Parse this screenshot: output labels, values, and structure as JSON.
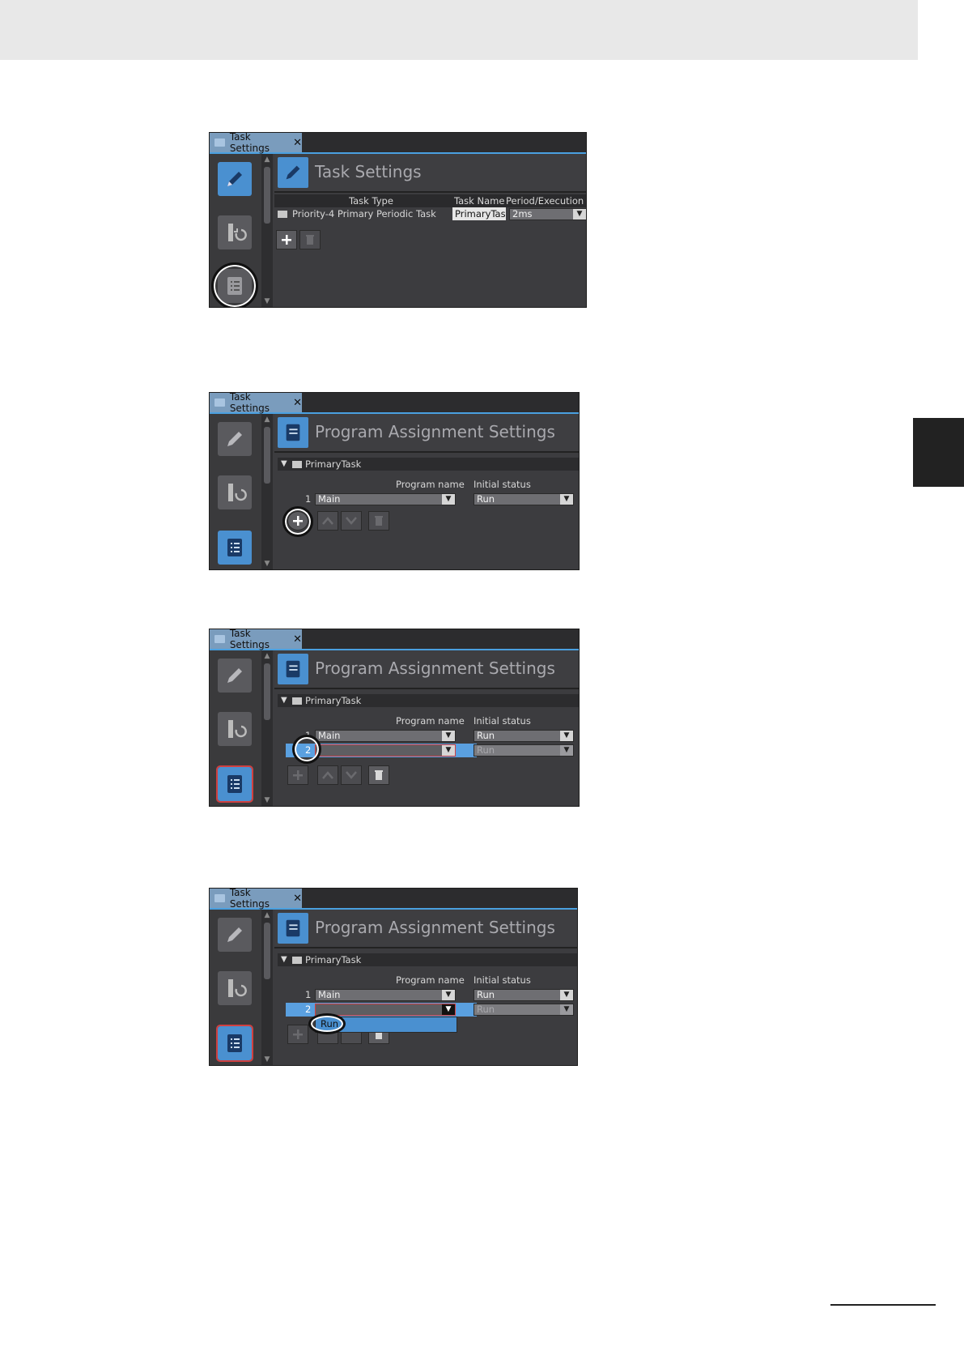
{
  "colors": {
    "accent": "#4a90d0",
    "header_band": "#e8e8e8",
    "side_tab": "#222222"
  },
  "icons": {
    "pencil": "pencil-icon",
    "revert": "revert-icon",
    "list": "list-icon",
    "add": "plus-icon",
    "delete": "trash-icon",
    "up": "chevron-up-icon",
    "down": "chevron-down-icon"
  },
  "shot1": {
    "tab_label": "Task Settings",
    "close_glyph": "✕",
    "title": "Task Settings",
    "columns": {
      "task_type": "Task Type",
      "task_name": "Task Name",
      "period": "Period/Execution C"
    },
    "row": {
      "task_type": "Priority-4 Primary Periodic Task",
      "task_name": "PrimaryTask",
      "period": "2ms"
    }
  },
  "shot2": {
    "tab_label": "Task Settings",
    "close_glyph": "✕",
    "title": "Program Assignment Settings",
    "group": "PrimaryTask",
    "col_program": "Program name",
    "col_status": "Initial status",
    "rows": [
      {
        "num": "1",
        "program": "Main",
        "status": "Run"
      }
    ]
  },
  "shot3": {
    "tab_label": "Task Settings",
    "close_glyph": "✕",
    "title": "Program Assignment Settings",
    "group": "PrimaryTask",
    "col_program": "Program name",
    "col_status": "Initial status",
    "rows": [
      {
        "num": "1",
        "program": "Main",
        "status": "Run"
      },
      {
        "num": "2",
        "program": "",
        "status": "Run"
      }
    ]
  },
  "shot4": {
    "tab_label": "Task Settings",
    "close_glyph": "✕",
    "title": "Program Assignment Settings",
    "group": "PrimaryTask",
    "col_program": "Program name",
    "col_status": "Initial status",
    "rows": [
      {
        "num": "1",
        "program": "Main",
        "status": "Run"
      },
      {
        "num": "2",
        "program": "",
        "status": "Run"
      }
    ],
    "dropdown_option": "Run"
  }
}
